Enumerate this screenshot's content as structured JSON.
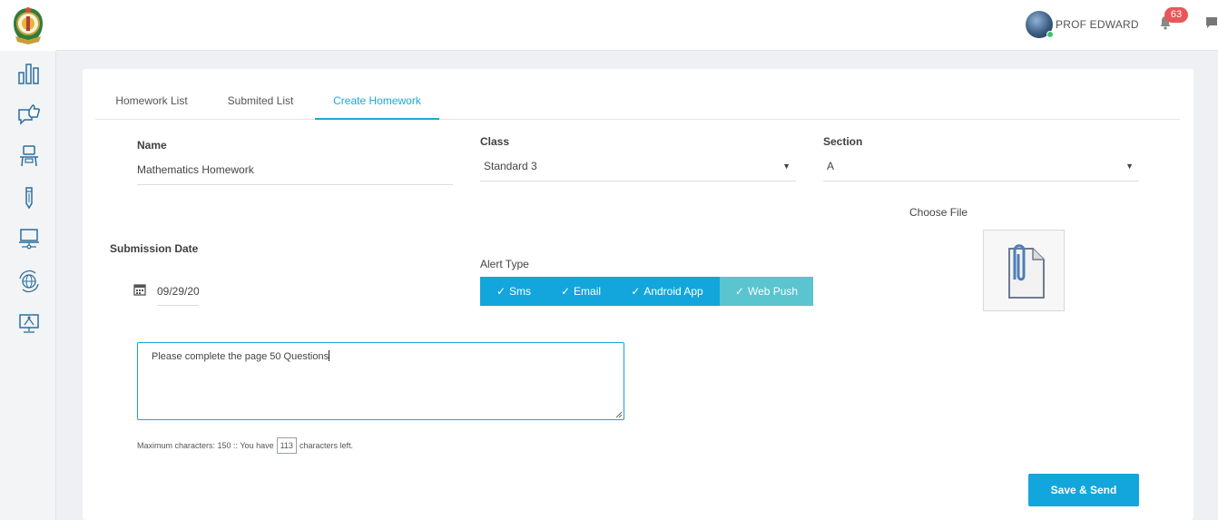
{
  "topbar": {
    "user_name": "PROF EDWARD",
    "notification_count": "63"
  },
  "sidebar": {
    "items": [
      {
        "icon": "bar-chart-icon"
      },
      {
        "icon": "thumbs-up-chat-icon"
      },
      {
        "icon": "classroom-desk-icon"
      },
      {
        "icon": "pencil-icon"
      },
      {
        "icon": "laptop-network-icon"
      },
      {
        "icon": "globe-refresh-icon"
      },
      {
        "icon": "presentation-monitor-icon"
      }
    ]
  },
  "tabs": [
    {
      "label": "Homework List",
      "active": false
    },
    {
      "label": "Submited List",
      "active": false
    },
    {
      "label": "Create Homework",
      "active": true
    }
  ],
  "form": {
    "name_label": "Name",
    "name_value": "Mathematics Homework",
    "class_label": "Class",
    "class_value": "Standard 3",
    "section_label": "Section",
    "section_value": "A",
    "choose_file_label": "Choose File",
    "submission_date_label": "Submission Date",
    "submission_date_value": "09/29/20",
    "alert_type_label": "Alert Type",
    "alert_options": [
      {
        "label": "Sms",
        "checked": true
      },
      {
        "label": "Email",
        "checked": true
      },
      {
        "label": "Android App",
        "checked": true
      },
      {
        "label": "Web Push",
        "checked": true
      }
    ],
    "description_value": "Please complete the page 50 Questions",
    "char_note_prefix": "Maximum characters: 150 :: You have",
    "chars_left": "113",
    "char_note_suffix": "characters left.",
    "save_label": "Save & Send"
  },
  "colors": {
    "accent": "#13a6dc",
    "web_push_bg": "#5ac4cf",
    "badge": "#e85757",
    "online": "#3cc46d"
  }
}
